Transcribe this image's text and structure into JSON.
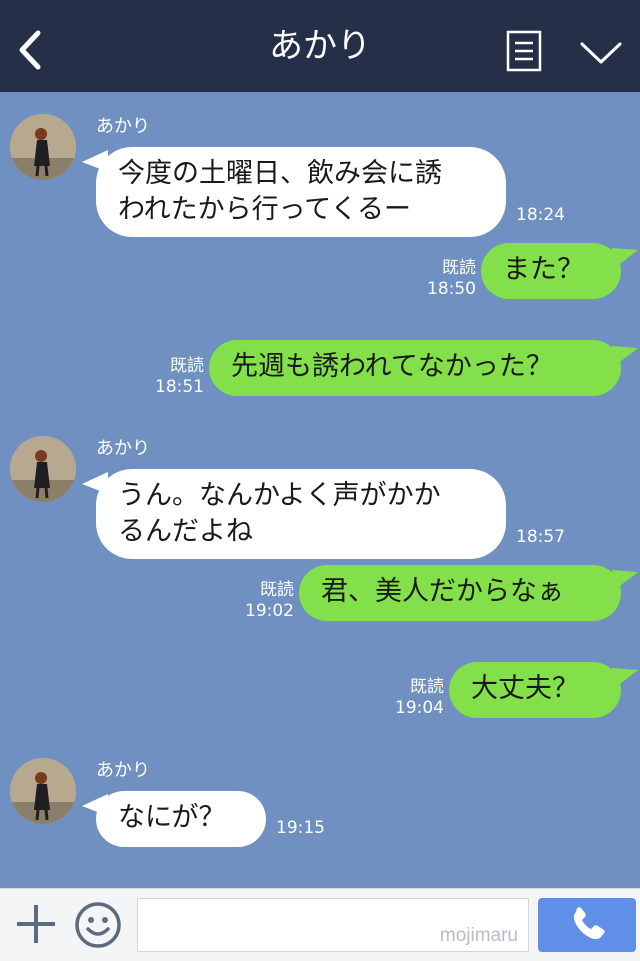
{
  "header": {
    "title": "あかり",
    "icons": [
      "chevron-left-icon",
      "menu-list-icon",
      "chevron-down-icon"
    ]
  },
  "messages": [
    {
      "sender": "あかり",
      "text": "今度の土曜日、飲み会に誘\nわれたから行ってくるー",
      "time": "18:24",
      "direction": "in"
    },
    {
      "read": "既読",
      "time": "18:50",
      "text": "また？",
      "direction": "out"
    },
    {
      "read": "既読",
      "time": "18:51",
      "text": "先週も誘われてなかった？",
      "direction": "out"
    },
    {
      "sender": "あかり",
      "text": "うん。なんかよく声がかか\nるんだよね",
      "time": "18:57",
      "direction": "in"
    },
    {
      "read": "既読",
      "time": "19:02",
      "text": "君、美人だからなぁ",
      "direction": "out"
    },
    {
      "read": "既読",
      "time": "19:04",
      "text": "大丈夫？",
      "direction": "out"
    },
    {
      "sender": "あかり",
      "text": "なにが？",
      "time": "19:15",
      "direction": "in"
    }
  ],
  "footer": {
    "input_placeholder": "",
    "watermark": "mojimaru",
    "icons": [
      "plus-icon",
      "emoji-icon",
      "phone-icon"
    ]
  },
  "colors": {
    "header_bg": "#252f48",
    "chat_bg": "#7090c1",
    "outgoing_bubble": "#84e04a",
    "incoming_bubble": "#ffffff",
    "call_button": "#5f8fe6"
  }
}
